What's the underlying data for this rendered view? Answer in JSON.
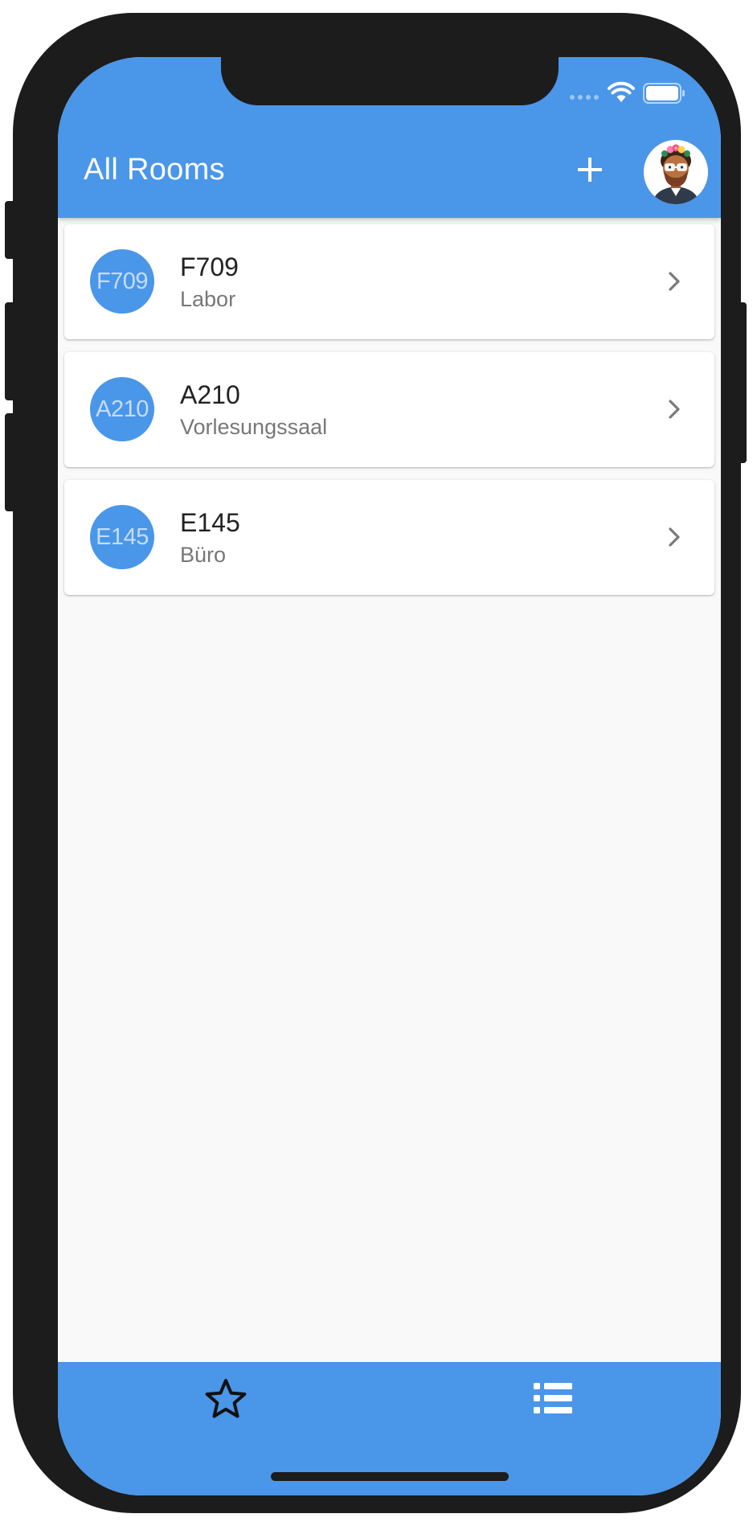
{
  "status_bar": {
    "wifi_icon": "wifi-icon",
    "battery_icon": "battery-icon",
    "signal_icon": "signal-dots-icon"
  },
  "appbar": {
    "title": "All Rooms",
    "add_icon": "plus-icon",
    "avatar_icon": "user-avatar"
  },
  "rooms": [
    {
      "badge": "F709",
      "name": "F709",
      "type": "Labor"
    },
    {
      "badge": "A210",
      "name": "A210",
      "type": "Vorlesungssaal"
    },
    {
      "badge": "E145",
      "name": "E145",
      "type": "Büro"
    }
  ],
  "bottom_nav": {
    "items": [
      {
        "icon": "star-icon"
      },
      {
        "icon": "list-icon"
      }
    ]
  },
  "colors": {
    "primary": "#4a96e9",
    "background": "#f9f9f9",
    "card": "#ffffff",
    "title_text": "#ffffff",
    "room_name_text": "#222222",
    "room_type_text": "#777777",
    "frame": "#1c1c1c"
  }
}
